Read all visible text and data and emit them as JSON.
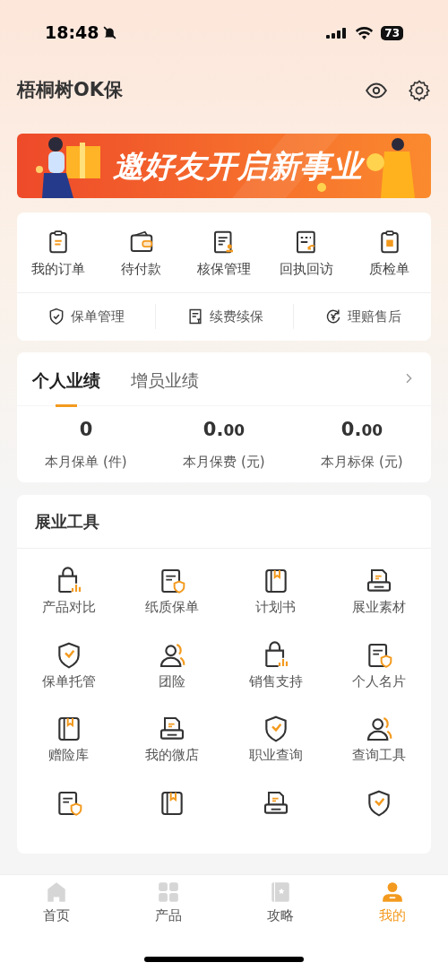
{
  "status_bar": {
    "time": "18:48",
    "battery": "73"
  },
  "header": {
    "title": "梧桐树OK保"
  },
  "banner": {
    "text": "邀好友开启新事业"
  },
  "orders": {
    "items": [
      "我的订单",
      "待付款",
      "核保管理",
      "回执回访",
      "质检单"
    ],
    "links": [
      "保单管理",
      "续费续保",
      "理赔售后"
    ]
  },
  "performance": {
    "tabs": [
      {
        "label": "个人业绩",
        "selected": true
      },
      {
        "label": "增员业绩",
        "selected": false
      }
    ],
    "stats": [
      {
        "value": "0",
        "label": "本月保单 (件)"
      },
      {
        "value": "0.",
        "decimals": "00",
        "label": "本月保费 (元)"
      },
      {
        "value": "0.",
        "decimals": "00",
        "label": "本月标保 (元)"
      }
    ]
  },
  "tools": {
    "title": "展业工具",
    "items": [
      "产品对比",
      "纸质保单",
      "计划书",
      "展业素材",
      "保单托管",
      "团险",
      "销售支持",
      "个人名片",
      "赠险库",
      "我的微店",
      "职业查询",
      "查询工具"
    ]
  },
  "tab_bar": [
    {
      "label": "首页",
      "selected": false
    },
    {
      "label": "产品",
      "selected": false
    },
    {
      "label": "攻略",
      "selected": false
    },
    {
      "label": "我的",
      "selected": true
    }
  ]
}
